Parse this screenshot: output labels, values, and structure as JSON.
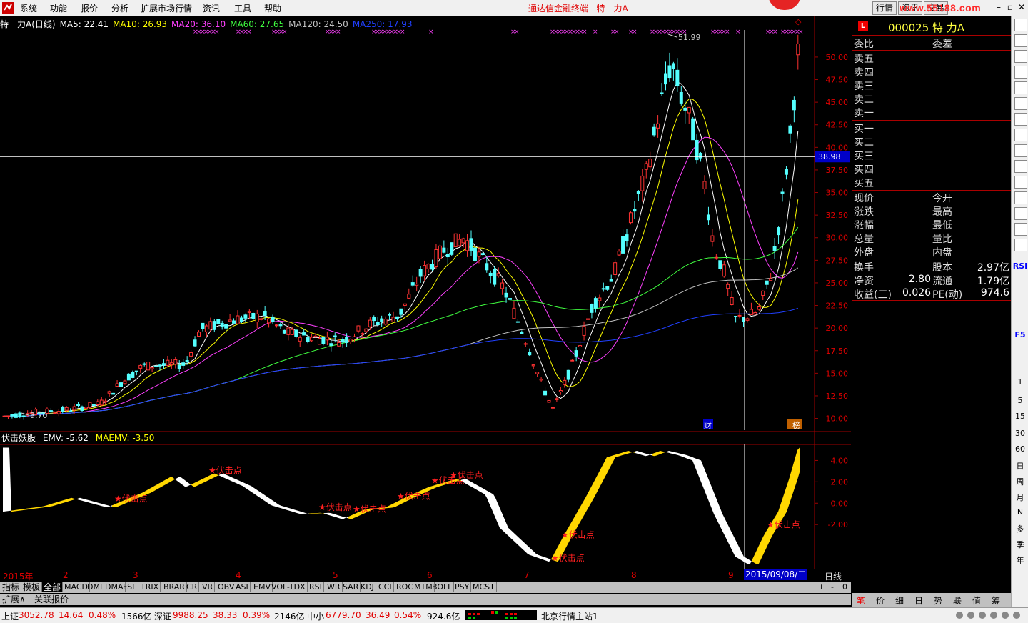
{
  "menu": {
    "items": [
      "系统",
      "功能",
      "报价",
      "分析",
      "扩展市场行情",
      "资讯",
      "工具",
      "帮助"
    ],
    "center_title": "通达信金融终端",
    "center_stock": "特　力A",
    "tabs": [
      "行情",
      "资讯",
      "交易"
    ],
    "watermark": "www.55188.com"
  },
  "price_panel": {
    "stock": "特　力A(日线)",
    "ma": [
      {
        "label": "MA5: 22.41",
        "color": "#ffffff"
      },
      {
        "label": "MA10: 26.93",
        "color": "#ffff00"
      },
      {
        "label": "MA20: 36.10",
        "color": "#ff40ff"
      },
      {
        "label": "MA60: 27.65",
        "color": "#40ff40"
      },
      {
        "label": "MA120: 24.50",
        "color": "#c0c0c0"
      },
      {
        "label": "MA250: 17.93",
        "color": "#2040ff"
      }
    ],
    "high_label": "51.99",
    "low_label": "9.70",
    "cursor_price": "38.98",
    "badge_cai": "财",
    "badge_bang": "榜"
  },
  "indicator": {
    "name": "伏击妖股",
    "emv": "EMV: -5.62",
    "maemv": "MAEMV: -3.50",
    "signal_label": "★伏击点"
  },
  "date_axis": {
    "labels": [
      "2015年",
      "2",
      "3",
      "4",
      "5",
      "6",
      "7",
      "8",
      "9"
    ],
    "cursor_date": "2015/09/08/二",
    "period": "日线"
  },
  "bottom_tabs": {
    "tabs": [
      "指标",
      "模板",
      "全部",
      "MACD",
      "DMI",
      "DMA",
      "FSL",
      "TRIX",
      "BRAR",
      "CR",
      "VR",
      "OBV",
      "ASI",
      "EMV",
      "VOL-TDX",
      "RSI",
      "WR",
      "SAR",
      "KDJ",
      "CCI",
      "ROC",
      "MTM",
      "BOLL",
      "PSY",
      "MCST"
    ],
    "controls": [
      "+",
      "-",
      "0"
    ],
    "second_row": [
      "扩展∧",
      "关联报价"
    ]
  },
  "chart_data": [
    {
      "type": "candlestick",
      "title": "特　力A(日线)",
      "y_axis_ticks": [
        "50.00",
        "47.50",
        "45.00",
        "42.50",
        "40.00",
        "37.50",
        "35.00",
        "32.50",
        "30.00",
        "27.50",
        "25.00",
        "22.50",
        "20.00",
        "17.50",
        "15.00",
        "12.50",
        "10.00"
      ],
      "ylim": [
        8.7,
        53.0
      ],
      "x_range": [
        "2015-01",
        "2015-09"
      ],
      "series_names": [
        "MA5",
        "MA10",
        "MA20",
        "MA60",
        "MA120",
        "MA250"
      ],
      "ma_current": {
        "MA5": 22.41,
        "MA10": 26.93,
        "MA20": 36.1,
        "MA60": 27.65,
        "MA120": 24.5,
        "MA250": 17.93
      },
      "max": 51.99,
      "min": 9.7,
      "cursor_value": 38.98
    },
    {
      "type": "area",
      "title": "伏击妖股",
      "y_axis_ticks": [
        "4.00",
        "2.00",
        "0.00",
        "-2.00"
      ],
      "ylim": [
        -6.2,
        5.5
      ],
      "series_names": [
        "EMV",
        "MAEMV"
      ],
      "current": {
        "EMV": -5.62,
        "MAEMV": -3.5
      },
      "signals": [
        {
          "date": "2015-02",
          "text": "★伏击点"
        },
        {
          "date": "2015-03",
          "text": "★伏击点"
        },
        {
          "date": "2015-04",
          "text": "★伏击点"
        },
        {
          "date": "2015-05",
          "text": "★伏击点"
        },
        {
          "date": "2015-05",
          "text": "★伏击点"
        },
        {
          "date": "2015-06",
          "text": "★伏击点"
        },
        {
          "date": "2015-06",
          "text": "★伏击点"
        },
        {
          "date": "2015-07",
          "text": "★伏击点"
        },
        {
          "date": "2015-07",
          "text": "★伏击点"
        },
        {
          "date": "2015-09",
          "text": "★伏击点"
        }
      ]
    }
  ],
  "right_panel": {
    "code_title": "000025 特 力A",
    "ratio_row": {
      "k": "委比",
      "k2": "委差"
    },
    "sell": [
      "卖五",
      "卖四",
      "卖三",
      "卖二",
      "卖一"
    ],
    "buy": [
      "买一",
      "买二",
      "买三",
      "买四",
      "买五"
    ],
    "stats": [
      {
        "k": "现价",
        "v": "",
        "k2": "今开",
        "v2": ""
      },
      {
        "k": "涨跌",
        "v": "",
        "k2": "最高",
        "v2": ""
      },
      {
        "k": "涨幅",
        "v": "",
        "k2": "最低",
        "v2": ""
      },
      {
        "k": "总量",
        "v": "",
        "k2": "量比",
        "v2": ""
      },
      {
        "k": "外盘",
        "v": "",
        "k2": "内盘",
        "v2": ""
      }
    ],
    "fund": [
      {
        "k": "换手",
        "v": "",
        "k2": "股本",
        "v2": "2.97亿"
      },
      {
        "k": "净资",
        "v": "2.80",
        "k2": "流通",
        "v2": "1.79亿"
      },
      {
        "k": "收益(三)",
        "v": "0.026",
        "k2": "PE(动)",
        "v2": "974.6"
      }
    ],
    "tabs": [
      "笔",
      "价",
      "细",
      "日",
      "势",
      "联",
      "值",
      "筹"
    ]
  },
  "side_toolbar": {
    "labels": [
      "RSI",
      "F5",
      "1",
      "5",
      "15",
      "30",
      "60",
      "日",
      "周",
      "月",
      "N",
      "多",
      "季",
      "年"
    ]
  },
  "status": {
    "sh_label": "上证",
    "sh_value": "3052.78",
    "sh_change": "14.64",
    "sh_pct": "0.48%",
    "sh_amount": "1566亿",
    "sz_label": "深证",
    "sz_value": "9988.25",
    "sz_change": "38.33",
    "sz_pct": "0.39%",
    "sz_amount": "2146亿",
    "zx_label": "中小",
    "zx_value": "6779.70",
    "zx_change": "36.49",
    "zx_pct": "0.54%",
    "zx_amount": "924.6亿",
    "server": "北京行情主站1"
  },
  "colors": {
    "up": "#ff3232",
    "down": "#54ffff",
    "emv_fill": "#ffd700",
    "emv_white": "#ffffff",
    "border": "#a00000"
  }
}
